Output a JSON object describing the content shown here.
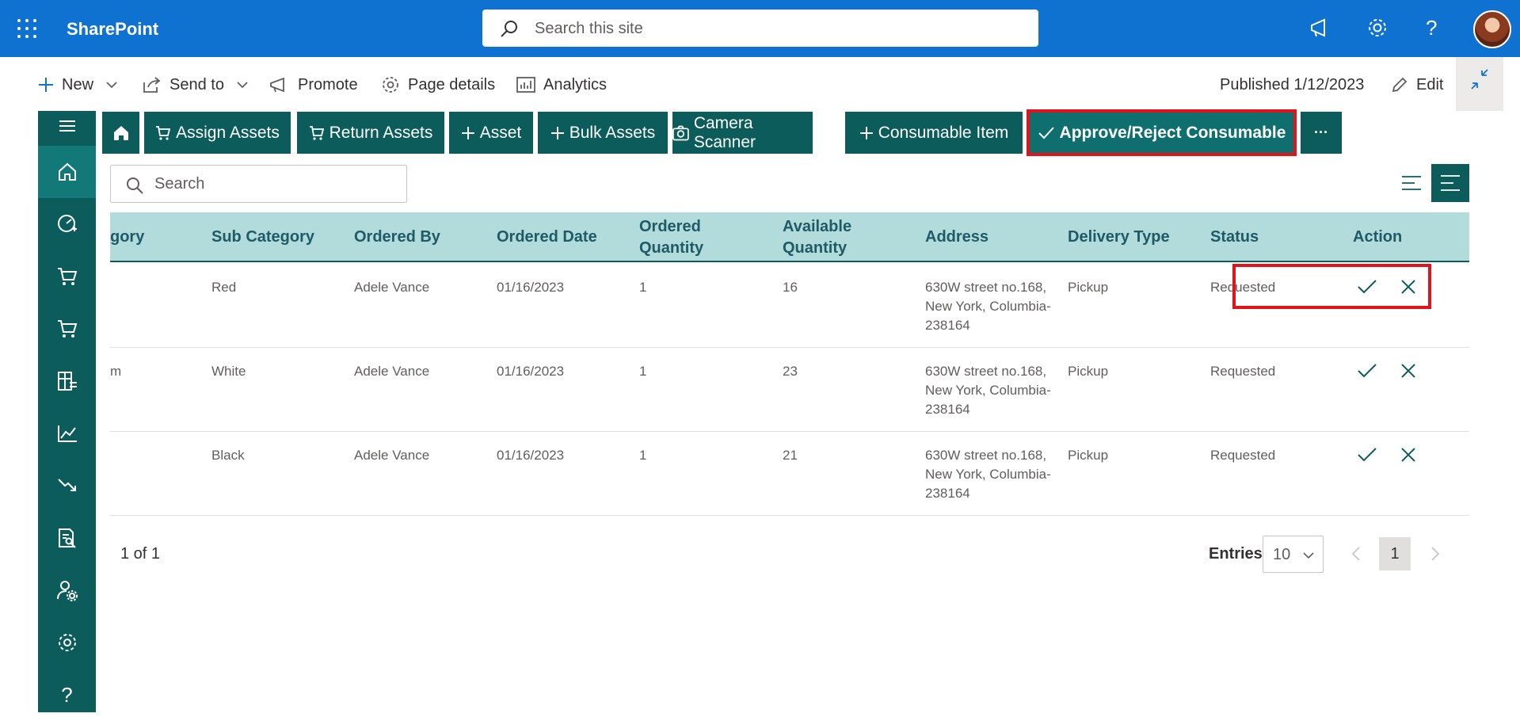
{
  "suite": {
    "brand": "SharePoint",
    "search_placeholder": "Search this site"
  },
  "commandbar": {
    "new": "New",
    "send_to": "Send to",
    "promote": "Promote",
    "page_details": "Page details",
    "analytics": "Analytics",
    "published": "Published 1/12/2023",
    "edit": "Edit"
  },
  "toolbar": {
    "assign_assets": "Assign Assets",
    "return_assets": "Return Assets",
    "asset": "Asset",
    "bulk_assets": "Bulk Assets",
    "camera_scanner": "Camera Scanner",
    "consumable_item": "Consumable Item",
    "approve_reject": "Approve/Reject Consumable",
    "more": "···"
  },
  "list": {
    "search_placeholder": "Search",
    "columns": [
      "gory",
      "Sub Category",
      "Ordered By",
      "Ordered Date",
      "Ordered Quantity",
      "Available Quantity",
      "Address",
      "Delivery Type",
      "Status",
      "Action"
    ],
    "rows": [
      {
        "category": "",
        "sub_category": "Red",
        "ordered_by": "Adele Vance",
        "ordered_date": "01/16/2023",
        "ordered_qty": "1",
        "available_qty": "16",
        "address": "630W street no.168, New York, Columbia-238164",
        "delivery_type": "Pickup",
        "status": "Requested"
      },
      {
        "category": "m",
        "sub_category": "White",
        "ordered_by": "Adele Vance",
        "ordered_date": "01/16/2023",
        "ordered_qty": "1",
        "available_qty": "23",
        "address": "630W street no.168, New York, Columbia-238164",
        "delivery_type": "Pickup",
        "status": "Requested"
      },
      {
        "category": "",
        "sub_category": "Black",
        "ordered_by": "Adele Vance",
        "ordered_date": "01/16/2023",
        "ordered_qty": "1",
        "available_qty": "21",
        "address": "630W street no.168, New York, Columbia-238164",
        "delivery_type": "Pickup",
        "status": "Requested"
      }
    ]
  },
  "footer": {
    "count": "1 of 1",
    "entries_label": "Entries",
    "entries_value": "10",
    "current_page": "1"
  },
  "colors": {
    "suite_blue": "#0f72d1",
    "teal": "#0c5c5c",
    "header_teal": "#b2dcdc",
    "highlight_red": "#e0141a"
  }
}
